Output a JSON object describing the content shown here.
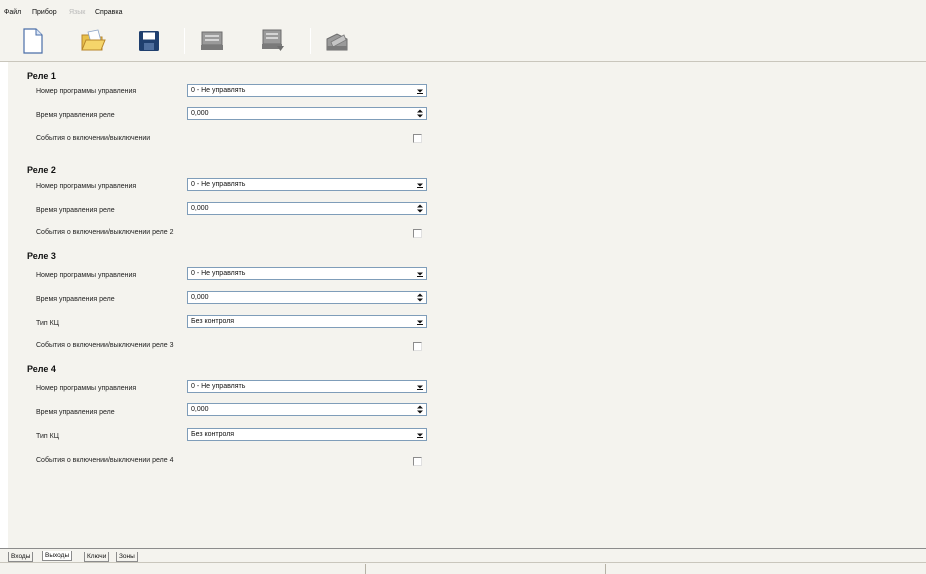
{
  "menu": {
    "file": "Файл",
    "device": "Прибор",
    "language": "Язык",
    "help": "Справка"
  },
  "toolbar": {
    "icons": [
      "new-file-icon",
      "open-folder-icon",
      "save-icon",
      "read-from-device-icon",
      "write-to-device-icon",
      "send-icon"
    ]
  },
  "sections": [
    {
      "title": "Реле 1",
      "program_label": "Номер программы управления",
      "program_value": "0 - Не управлять",
      "time_label": "Время управления реле",
      "time_value": "0,000",
      "events_label": "События о включении/выключении"
    },
    {
      "title": "Реле 2",
      "program_label": "Номер программы управления",
      "program_value": "0 - Не управлять",
      "time_label": "Время управления реле",
      "time_value": "0,000",
      "events_label": "События о включении/выключении реле 2"
    },
    {
      "title": "Реле 3",
      "program_label": "Номер программы управления",
      "program_value": "0 - Не управлять",
      "time_label": "Время управления реле",
      "time_value": "0,000",
      "kc_label": "Тип КЦ",
      "kc_value": "Без контроля",
      "events_label": "События о включении/выключении реле 3"
    },
    {
      "title": "Реле 4",
      "program_label": "Номер программы управления",
      "program_value": "0 - Не управлять",
      "time_label": "Время управления реле",
      "time_value": "0,000",
      "kc_label": "Тип КЦ",
      "kc_value": "Без контроля",
      "events_label": "События о включении/выключении реле 4"
    }
  ],
  "tabs": [
    "Входы",
    "Выходы",
    "Ключи",
    "Зоны"
  ],
  "colors": {
    "background": "#f4f3ee",
    "field_border": "#7f9db9",
    "save_icon": "#1f3f6e"
  }
}
